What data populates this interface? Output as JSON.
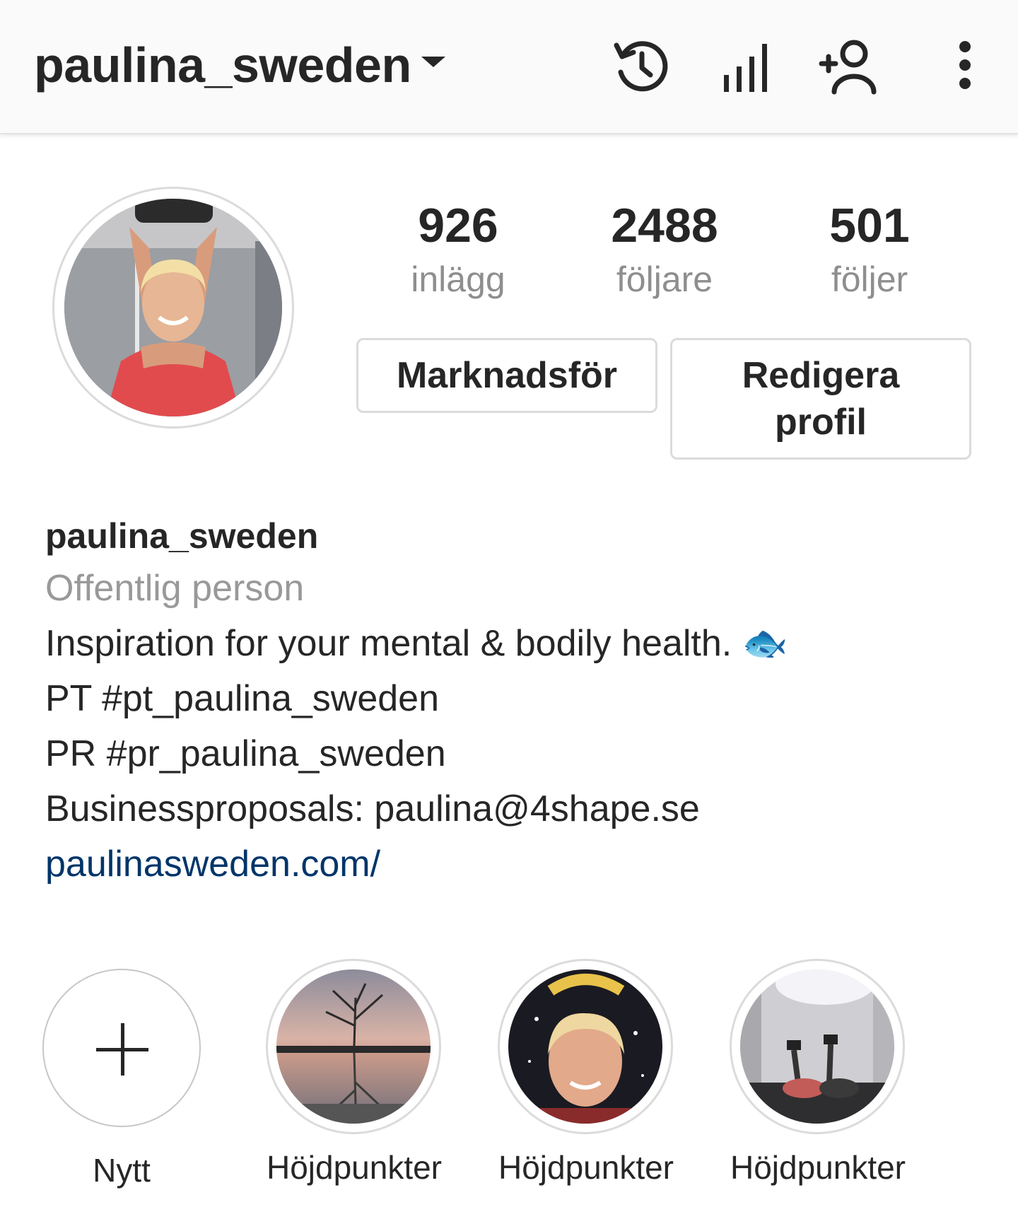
{
  "header": {
    "username": "paulina_sweden",
    "icons": [
      "archive-history-icon",
      "insights-bar-chart-icon",
      "discover-people-icon",
      "more-options-icon"
    ]
  },
  "profile": {
    "stats": [
      {
        "value": "926",
        "label": "inlägg"
      },
      {
        "value": "2488",
        "label": "följare"
      },
      {
        "value": "501",
        "label": "följer"
      }
    ],
    "buttons": {
      "promote": "Marknadsför",
      "edit_line1": "Redigera",
      "edit_line2": "profil"
    }
  },
  "bio": {
    "name": "paulina_sweden",
    "category": "Offentlig person",
    "lines": [
      "Inspiration for your mental & bodily health. 🐟",
      "PT #pt_paulina_sweden",
      "PR #pr_paulina_sweden",
      "Businessproposals: paulina@4shape.se"
    ],
    "link": "paulinasweden.com/"
  },
  "highlights": {
    "new_label": "Nytt",
    "items": [
      {
        "label": "Höjdpunkter",
        "thumb": "lake-sunset"
      },
      {
        "label": "Höjdpunkter",
        "thumb": "selfie-2018"
      },
      {
        "label": "Höjdpunkter",
        "thumb": "dumbbell-workout"
      }
    ]
  },
  "colors": {
    "link": "#003569",
    "secondary_text": "#8e8e8e",
    "border": "#dbdbdb",
    "topbar_bg": "#fafafa"
  }
}
